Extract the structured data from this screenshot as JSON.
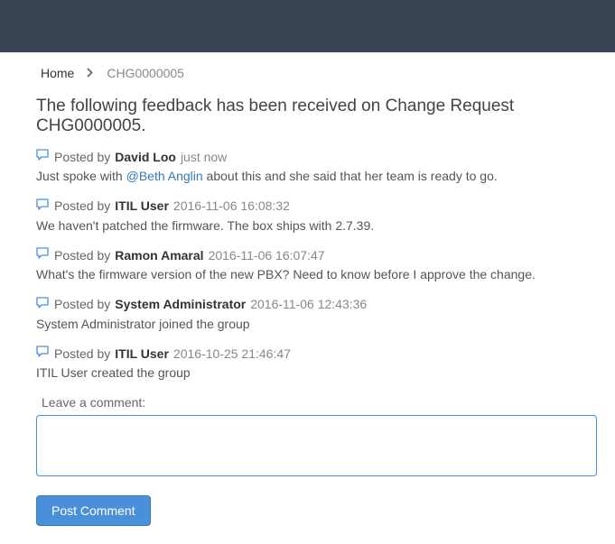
{
  "breadcrumb": {
    "home": "Home",
    "current": "CHG0000005"
  },
  "page_title": "The following feedback has been received on Change Request CHG0000005.",
  "posted_by_prefix": "Posted by",
  "comments": [
    {
      "author": "David Loo",
      "timestamp": "just now",
      "body_pre": "Just spoke with ",
      "mention": "@Beth Anglin",
      "body_post": " about this and she said that her team is ready to go."
    },
    {
      "author": "ITIL User",
      "timestamp": "2016-11-06 16:08:32",
      "body": "We haven't patched the firmware. The box ships with 2.7.39."
    },
    {
      "author": "Ramon Amaral",
      "timestamp": "2016-11-06 16:07:47",
      "body": "What's the firmware version of the new PBX? Need to know before I approve the change."
    },
    {
      "author": "System Administrator",
      "timestamp": "2016-11-06 12:43:36",
      "body": "System Administrator joined the group"
    },
    {
      "author": "ITIL User",
      "timestamp": "2016-10-25 21:46:47",
      "body": "ITIL User created the group"
    }
  ],
  "form": {
    "label": "Leave a comment:",
    "button": "Post Comment"
  }
}
